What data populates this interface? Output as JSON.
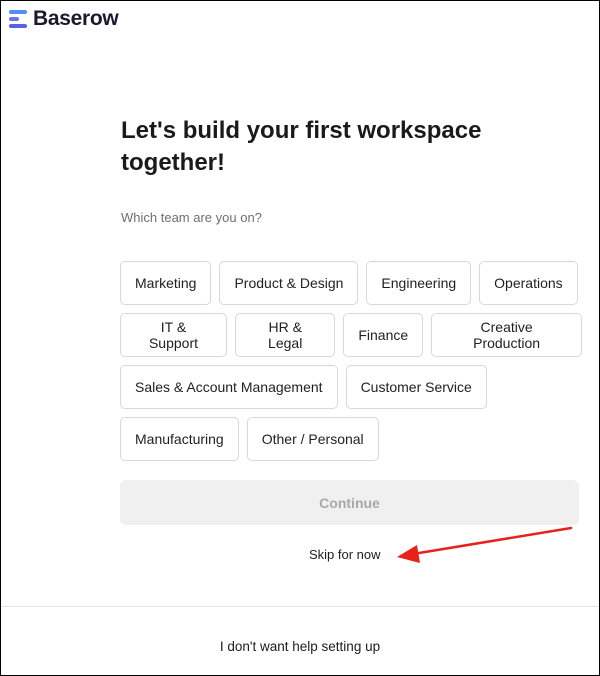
{
  "brand": {
    "name": "Baserow"
  },
  "onboarding": {
    "title": "Let's build your first workspace together!",
    "question": "Which team are you on?",
    "teams": [
      [
        "Marketing",
        "Product & Design",
        "Engineering",
        "Operations"
      ],
      [
        "IT & Support",
        "HR & Legal",
        "Finance",
        "Creative Production"
      ],
      [
        "Sales & Account Management",
        "Customer Service"
      ],
      [
        "Manufacturing",
        "Other / Personal"
      ]
    ],
    "continue_label": "Continue",
    "skip_label": "Skip for now",
    "no_help_label": "I don't want help setting up"
  },
  "annotation": {
    "arrow_color": "#e8221b"
  },
  "colors": {
    "continue_bg": "#f0f0f0",
    "continue_text": "#a8a8a8",
    "chip_border": "#d7d8d9"
  }
}
